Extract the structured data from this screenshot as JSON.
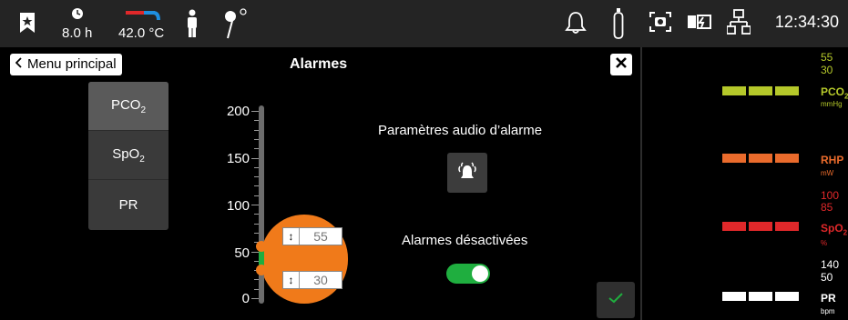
{
  "topbar": {
    "duration": "8.0 h",
    "temperature": "42.0 °C",
    "clock": "12:34:30"
  },
  "header": {
    "back_label": "Menu principal",
    "title": "Alarmes"
  },
  "params": [
    {
      "base": "PCO",
      "sub": "2",
      "active": true
    },
    {
      "base": "SpO",
      "sub": "2",
      "active": false
    },
    {
      "base": "PR",
      "sub": "",
      "active": false
    }
  ],
  "scale": {
    "ticks": [
      "200",
      "150",
      "100",
      "50",
      "0"
    ],
    "upper_limit": "55",
    "lower_limit": "30"
  },
  "audio": {
    "title": "Paramètres audio d’alarme"
  },
  "muted": {
    "title": "Alarmes désactivées",
    "enabled": true
  },
  "sidebar": {
    "pco2": {
      "high": "55",
      "low": "30",
      "name": "PCO",
      "sub": "2",
      "unit": "mmHg",
      "color": "#b5c82a"
    },
    "rhp": {
      "name": "RHP",
      "unit": "mW",
      "color": "#ea6b2c"
    },
    "spo2": {
      "high": "100",
      "low": "85",
      "name": "SpO",
      "sub": "2",
      "unit": "%",
      "color": "#e0282a"
    },
    "pr": {
      "high": "140",
      "low": "50",
      "name": "PR",
      "unit": "bpm",
      "color": "#ffffff"
    }
  },
  "colors": {
    "accent_green": "#1fae3f",
    "limit_orange": "#f07a1a"
  }
}
